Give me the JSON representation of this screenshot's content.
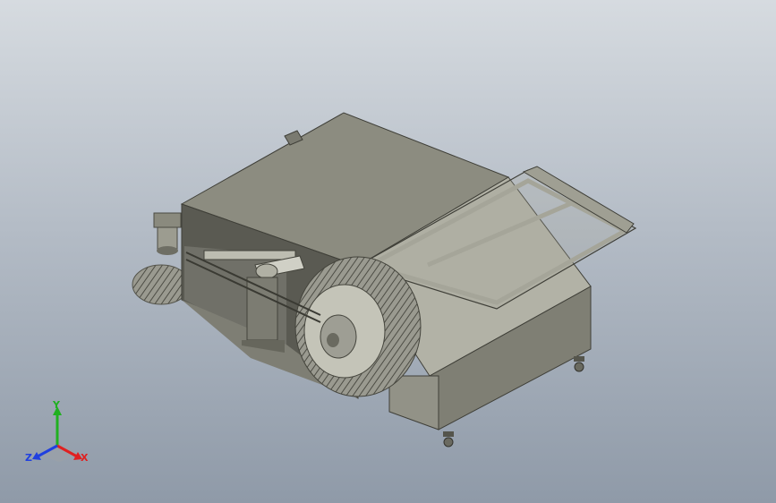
{
  "viewport": {
    "background_top": "#d6dbe0",
    "background_bottom": "#8f9aa8"
  },
  "model": {
    "body_color": "#8e8e80",
    "dark_color": "#5f5f55",
    "light_color": "#b3b3a8",
    "frame_color": "#a6a69a",
    "brush_color": "#7a7a70"
  },
  "triad": {
    "x_label": "X",
    "y_label": "Y",
    "z_label": "Z",
    "x_color": "#e02020",
    "y_color": "#20b020",
    "z_color": "#2040e0"
  }
}
